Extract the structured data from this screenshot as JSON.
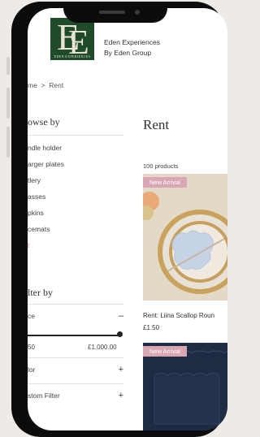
{
  "header": {
    "brand_name": "Eden Experiences",
    "brand_sub": "By Eden Group",
    "logo_monogram": "EE",
    "logo_tagline": "EDEN EXPERIENCES"
  },
  "breadcrumb": {
    "home": "me",
    "separator": ">",
    "current": "Rent"
  },
  "sidebar": {
    "browse_heading": "owse by",
    "categories": [
      {
        "label": "ndle holder"
      },
      {
        "label": "arger plates"
      },
      {
        "label": "tlery"
      },
      {
        "label": "asses"
      },
      {
        "label": "pkins"
      },
      {
        "label": "cemats"
      }
    ],
    "extra_link": "t",
    "filter_heading": "lter by",
    "price": {
      "label": "ce",
      "toggle": "–",
      "min_label": "50",
      "max_label": "£1,000.00",
      "slider_level": 1.0
    },
    "color_filter": {
      "label": "lor",
      "toggle": "+"
    },
    "custom_filter": {
      "label": "stom Filter",
      "toggle": "+"
    }
  },
  "main": {
    "title": "Rent",
    "product_count": "100 products",
    "products": [
      {
        "badge": "New Arrival",
        "name": "Rent: Liina Scallop Roun",
        "price": "£1.50"
      },
      {
        "badge": "New Arrival"
      }
    ]
  },
  "colors": {
    "logo_green": "#1f4a2b",
    "badge_pink": "#d8a6b4",
    "frame": "#0c0c0c"
  }
}
